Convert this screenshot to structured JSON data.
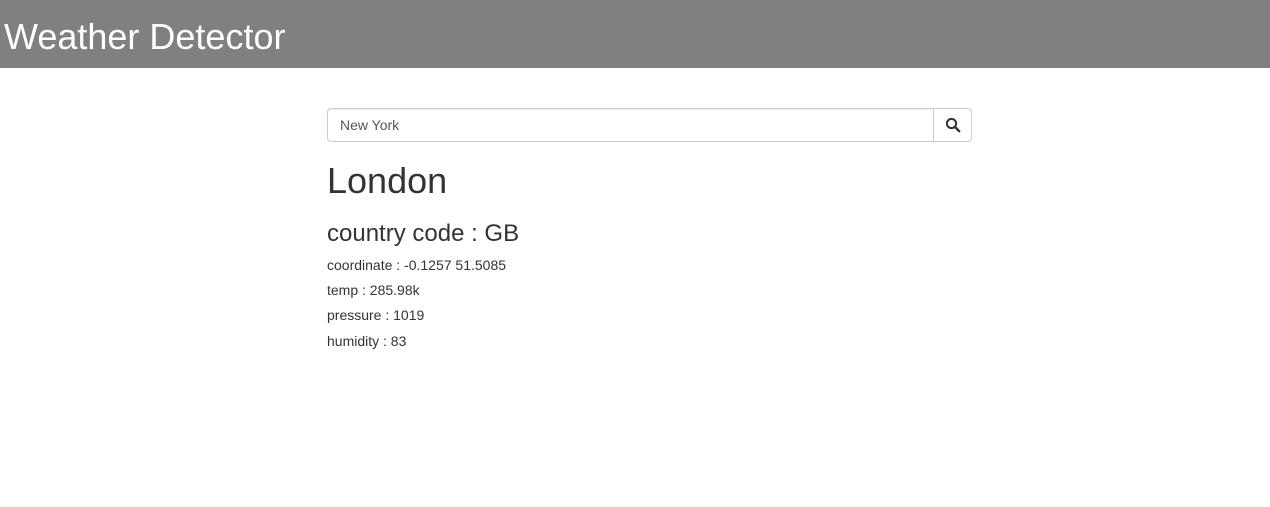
{
  "header": {
    "title": "Weather Detector",
    "background_color": "#808080",
    "title_color": "#ffffff"
  },
  "search": {
    "value": "New York",
    "button_icon": "search-icon"
  },
  "weather": {
    "city": "London",
    "country_code_text": "country code : GB",
    "coordinate_text": "coordinate : -0.1257 51.5085",
    "temp_text": "temp : 285.98k",
    "pressure_text": "pressure : 1019",
    "humidity_text": "humidity : 83"
  }
}
